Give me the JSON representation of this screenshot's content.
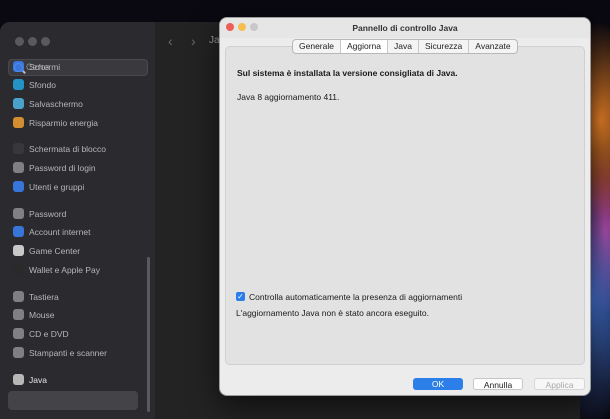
{
  "settings": {
    "search_placeholder": "Cerca",
    "content_title_partial": "Ja",
    "sidebar_items": [
      {
        "label": "Schermi",
        "icon": "display-icon",
        "color": "#3b82f6"
      },
      {
        "label": "Sfondo",
        "icon": "wallpaper-icon",
        "color": "#22a6e0"
      },
      {
        "label": "Salvaschermo",
        "icon": "screensaver-icon",
        "color": "#4fb6e8"
      },
      {
        "label": "Risparmio energia",
        "icon": "battery-icon",
        "color": "#f0a030"
      },
      {
        "label": "Schermata di blocco",
        "icon": "lock-screen-icon",
        "color": "#3a3a3e"
      },
      {
        "label": "Password di login",
        "icon": "login-password-icon",
        "color": "#8e8e93"
      },
      {
        "label": "Utenti e gruppi",
        "icon": "users-icon",
        "color": "#3b82f6"
      },
      {
        "label": "Password",
        "icon": "key-icon",
        "color": "#8e8e93"
      },
      {
        "label": "Account internet",
        "icon": "at-icon",
        "color": "#3b82f6"
      },
      {
        "label": "Game Center",
        "icon": "game-center-icon",
        "color": "#e4e4e4"
      },
      {
        "label": "Wallet e Apple Pay",
        "icon": "wallet-icon",
        "color": "#2a2a2a"
      },
      {
        "label": "Tastiera",
        "icon": "keyboard-icon",
        "color": "#8e8e93"
      },
      {
        "label": "Mouse",
        "icon": "mouse-icon",
        "color": "#8e8e93"
      },
      {
        "label": "CD e DVD",
        "icon": "disc-icon",
        "color": "#8e8e93"
      },
      {
        "label": "Stampanti e scanner",
        "icon": "printer-icon",
        "color": "#8e8e93"
      },
      {
        "label": "Java",
        "icon": "java-icon",
        "color": "#d0d0d0"
      }
    ]
  },
  "dialog": {
    "title": "Pannello di controllo Java",
    "tabs": [
      "Generale",
      "Aggiorna",
      "Java",
      "Sicurezza",
      "Avanzate"
    ],
    "active_tab": "Aggiorna",
    "headline": "Sul sistema è installata la versione consigliata di Java.",
    "version": "Java 8 aggiornamento 411.",
    "auto_check_label": "Controlla automaticamente la presenza di aggiornamenti",
    "auto_check_checked": true,
    "status": "L'aggiornamento Java non è stato ancora eseguito.",
    "buttons": {
      "ok": "OK",
      "cancel": "Annulla",
      "apply": "Applica"
    }
  },
  "colors": {
    "accent": "#2c7fe9",
    "close": "#ec5f57",
    "minimize": "#f4bf4f",
    "zoom": "#c8c8c8"
  }
}
